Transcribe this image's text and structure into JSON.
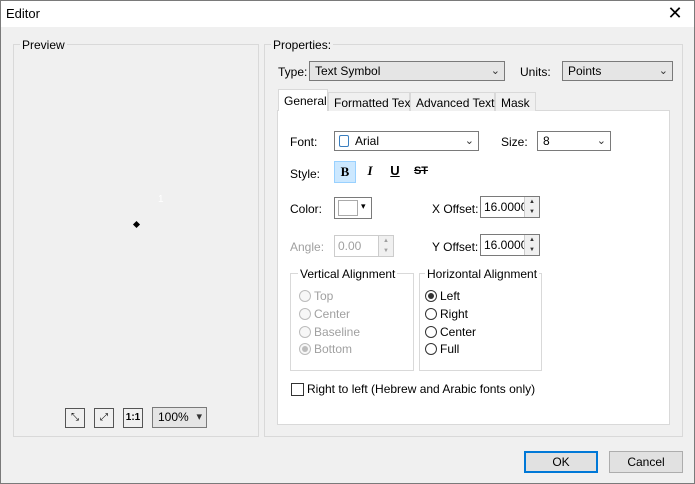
{
  "window": {
    "title": "Editor"
  },
  "preview": {
    "label": "Preview",
    "number_text": "1",
    "zoom": "100%"
  },
  "properties": {
    "label": "Properties:",
    "type_label": "Type:",
    "type_value": "Text Symbol",
    "units_label": "Units:",
    "units_value": "Points",
    "tabs": [
      {
        "label": "General"
      },
      {
        "label": "Formatted Text"
      },
      {
        "label": "Advanced Text"
      },
      {
        "label": "Mask"
      }
    ]
  },
  "general": {
    "font_label": "Font:",
    "font_value": "Arial",
    "size_label": "Size:",
    "size_value": "8",
    "style_label": "Style:",
    "style_buttons": {
      "bold": "B",
      "italic": "I",
      "underline": "U",
      "strike": "ST"
    },
    "color_label": "Color:",
    "x_offset_label": "X Offset:",
    "x_offset_value": "16.0000",
    "angle_label": "Angle:",
    "angle_value": "0.00",
    "y_offset_label": "Y Offset:",
    "y_offset_value": "16.0000",
    "vertical_alignment": {
      "label": "Vertical Alignment",
      "options": [
        "Top",
        "Center",
        "Baseline",
        "Bottom"
      ],
      "selected": "Bottom"
    },
    "horizontal_alignment": {
      "label": "Horizontal Alignment",
      "options": [
        "Left",
        "Right",
        "Center",
        "Full"
      ],
      "selected": "Left"
    },
    "rtl_label": "Right to left (Hebrew and Arabic fonts only)"
  },
  "footer": {
    "ok_label": "OK",
    "cancel_label": "Cancel"
  }
}
